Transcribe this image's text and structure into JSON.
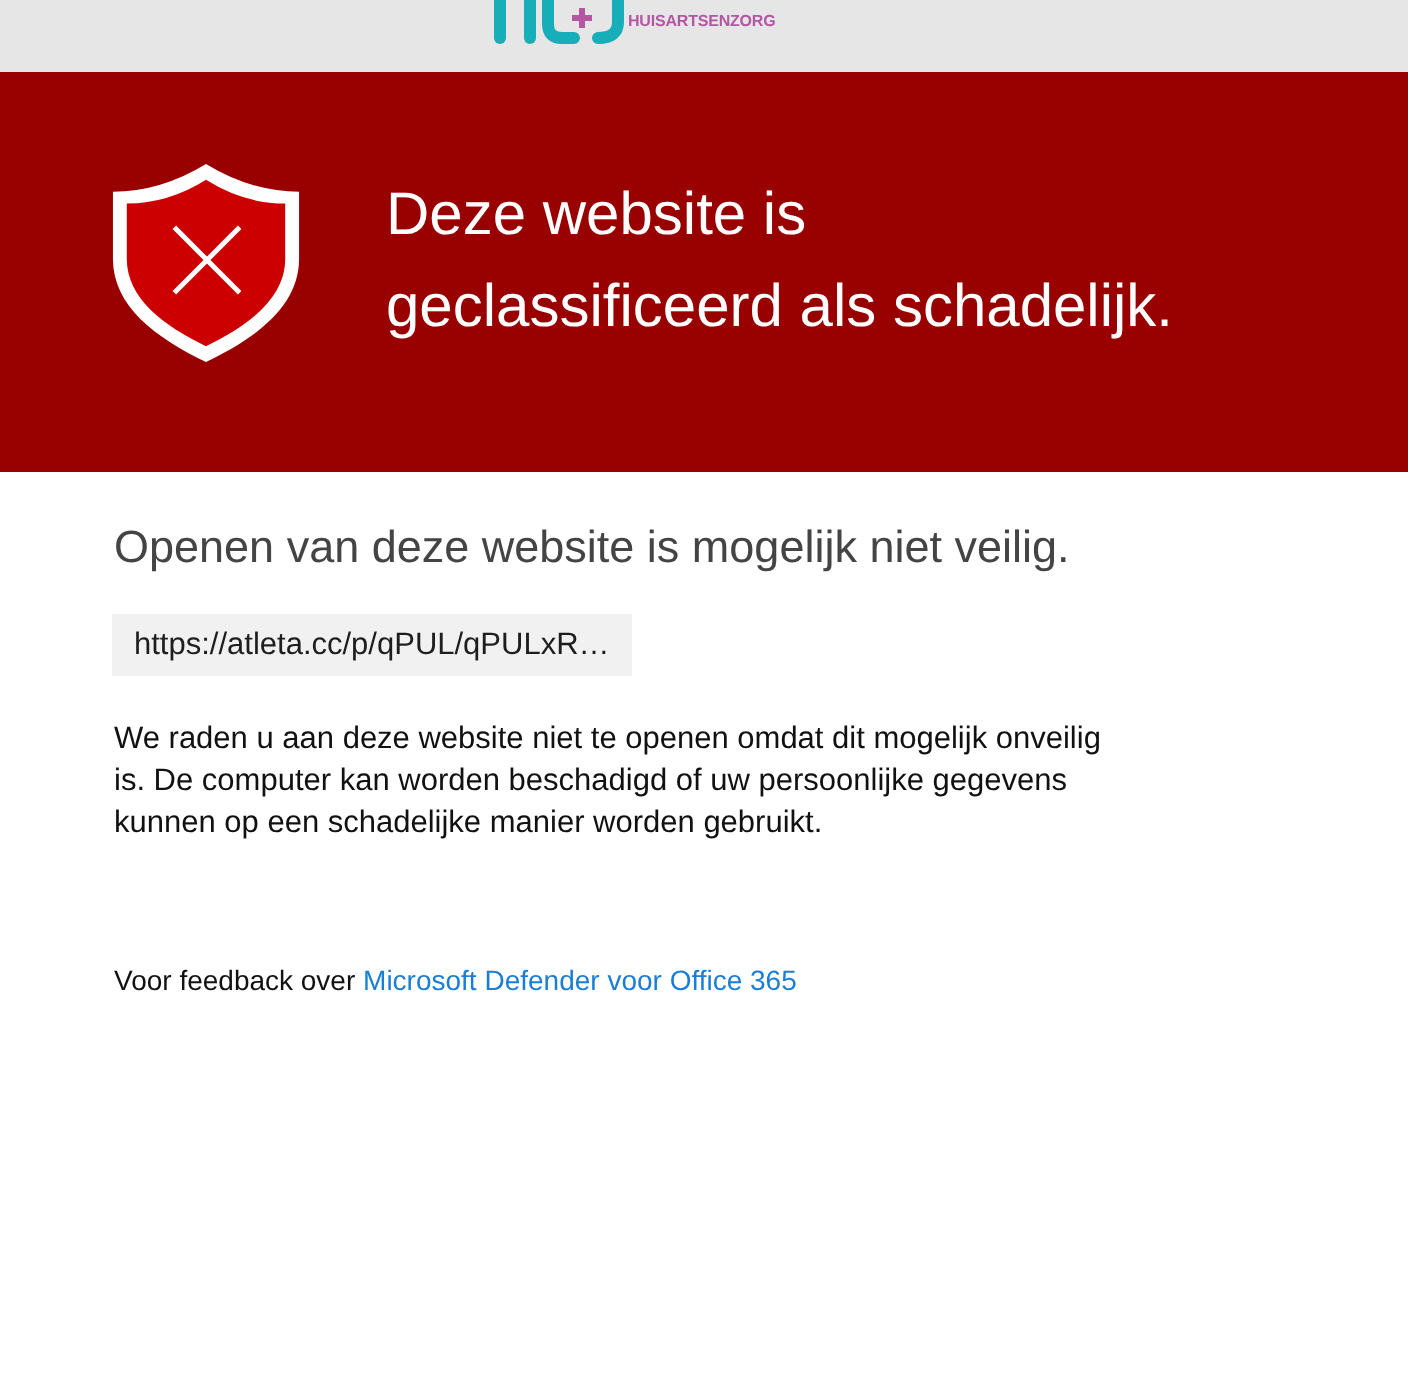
{
  "header": {
    "logo_text": "HUISARTSENZORG"
  },
  "banner": {
    "title": "Deze website is geclassificeerd als schadelijk."
  },
  "warning": {
    "heading": "Openen van deze website is mogelijk niet veilig.",
    "url": "https://atleta.cc/p/qPUL/qPULxR…",
    "message": "We raden u aan deze website niet te openen omdat dit mogelijk onveilig is. De computer kan worden beschadigd of uw persoonlijke gegevens kunnen op een schadelijke manier worden gebruikt."
  },
  "feedback": {
    "text": "Voor feedback over",
    "link": "Microsoft Defender voor Office 365"
  }
}
